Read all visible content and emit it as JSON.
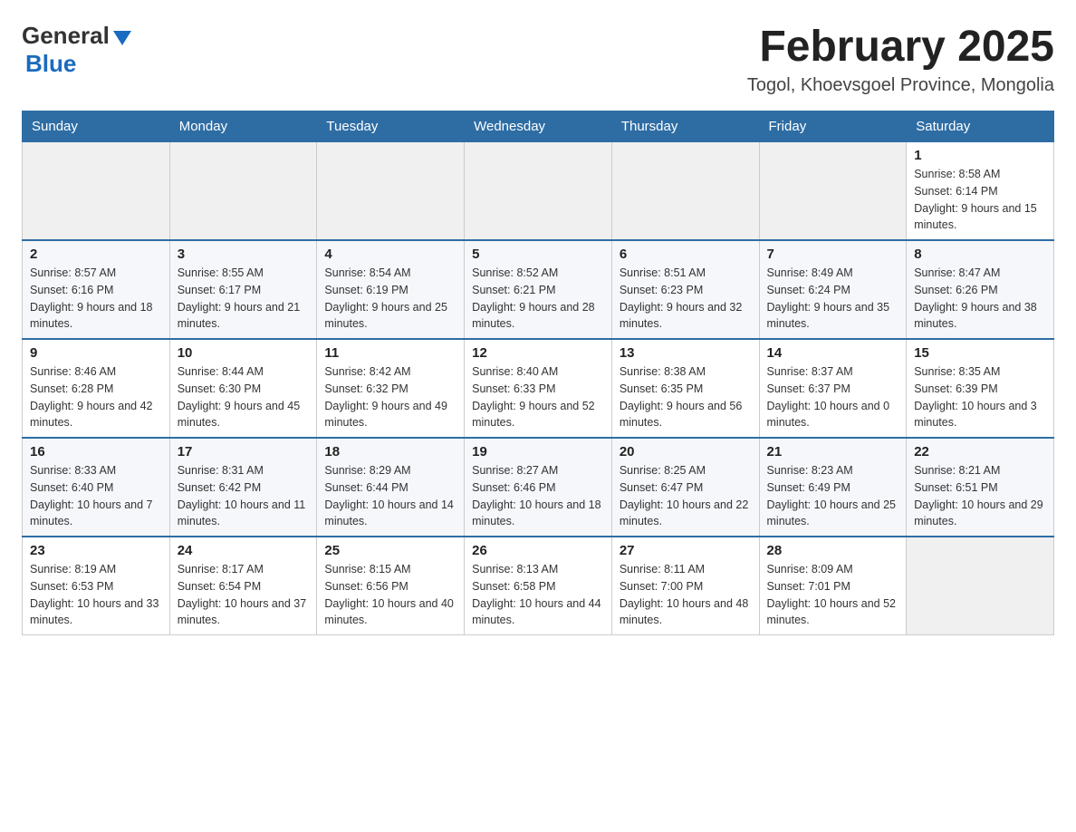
{
  "header": {
    "logo_general": "General",
    "logo_blue": "Blue",
    "month_title": "February 2025",
    "location": "Togol, Khoevsgoel Province, Mongolia"
  },
  "weekdays": [
    "Sunday",
    "Monday",
    "Tuesday",
    "Wednesday",
    "Thursday",
    "Friday",
    "Saturday"
  ],
  "weeks": [
    [
      {
        "day": "",
        "sunrise": "",
        "sunset": "",
        "daylight": "",
        "empty": true
      },
      {
        "day": "",
        "sunrise": "",
        "sunset": "",
        "daylight": "",
        "empty": true
      },
      {
        "day": "",
        "sunrise": "",
        "sunset": "",
        "daylight": "",
        "empty": true
      },
      {
        "day": "",
        "sunrise": "",
        "sunset": "",
        "daylight": "",
        "empty": true
      },
      {
        "day": "",
        "sunrise": "",
        "sunset": "",
        "daylight": "",
        "empty": true
      },
      {
        "day": "",
        "sunrise": "",
        "sunset": "",
        "daylight": "",
        "empty": true
      },
      {
        "day": "1",
        "sunrise": "Sunrise: 8:58 AM",
        "sunset": "Sunset: 6:14 PM",
        "daylight": "Daylight: 9 hours and 15 minutes.",
        "empty": false
      }
    ],
    [
      {
        "day": "2",
        "sunrise": "Sunrise: 8:57 AM",
        "sunset": "Sunset: 6:16 PM",
        "daylight": "Daylight: 9 hours and 18 minutes.",
        "empty": false
      },
      {
        "day": "3",
        "sunrise": "Sunrise: 8:55 AM",
        "sunset": "Sunset: 6:17 PM",
        "daylight": "Daylight: 9 hours and 21 minutes.",
        "empty": false
      },
      {
        "day": "4",
        "sunrise": "Sunrise: 8:54 AM",
        "sunset": "Sunset: 6:19 PM",
        "daylight": "Daylight: 9 hours and 25 minutes.",
        "empty": false
      },
      {
        "day": "5",
        "sunrise": "Sunrise: 8:52 AM",
        "sunset": "Sunset: 6:21 PM",
        "daylight": "Daylight: 9 hours and 28 minutes.",
        "empty": false
      },
      {
        "day": "6",
        "sunrise": "Sunrise: 8:51 AM",
        "sunset": "Sunset: 6:23 PM",
        "daylight": "Daylight: 9 hours and 32 minutes.",
        "empty": false
      },
      {
        "day": "7",
        "sunrise": "Sunrise: 8:49 AM",
        "sunset": "Sunset: 6:24 PM",
        "daylight": "Daylight: 9 hours and 35 minutes.",
        "empty": false
      },
      {
        "day": "8",
        "sunrise": "Sunrise: 8:47 AM",
        "sunset": "Sunset: 6:26 PM",
        "daylight": "Daylight: 9 hours and 38 minutes.",
        "empty": false
      }
    ],
    [
      {
        "day": "9",
        "sunrise": "Sunrise: 8:46 AM",
        "sunset": "Sunset: 6:28 PM",
        "daylight": "Daylight: 9 hours and 42 minutes.",
        "empty": false
      },
      {
        "day": "10",
        "sunrise": "Sunrise: 8:44 AM",
        "sunset": "Sunset: 6:30 PM",
        "daylight": "Daylight: 9 hours and 45 minutes.",
        "empty": false
      },
      {
        "day": "11",
        "sunrise": "Sunrise: 8:42 AM",
        "sunset": "Sunset: 6:32 PM",
        "daylight": "Daylight: 9 hours and 49 minutes.",
        "empty": false
      },
      {
        "day": "12",
        "sunrise": "Sunrise: 8:40 AM",
        "sunset": "Sunset: 6:33 PM",
        "daylight": "Daylight: 9 hours and 52 minutes.",
        "empty": false
      },
      {
        "day": "13",
        "sunrise": "Sunrise: 8:38 AM",
        "sunset": "Sunset: 6:35 PM",
        "daylight": "Daylight: 9 hours and 56 minutes.",
        "empty": false
      },
      {
        "day": "14",
        "sunrise": "Sunrise: 8:37 AM",
        "sunset": "Sunset: 6:37 PM",
        "daylight": "Daylight: 10 hours and 0 minutes.",
        "empty": false
      },
      {
        "day": "15",
        "sunrise": "Sunrise: 8:35 AM",
        "sunset": "Sunset: 6:39 PM",
        "daylight": "Daylight: 10 hours and 3 minutes.",
        "empty": false
      }
    ],
    [
      {
        "day": "16",
        "sunrise": "Sunrise: 8:33 AM",
        "sunset": "Sunset: 6:40 PM",
        "daylight": "Daylight: 10 hours and 7 minutes.",
        "empty": false
      },
      {
        "day": "17",
        "sunrise": "Sunrise: 8:31 AM",
        "sunset": "Sunset: 6:42 PM",
        "daylight": "Daylight: 10 hours and 11 minutes.",
        "empty": false
      },
      {
        "day": "18",
        "sunrise": "Sunrise: 8:29 AM",
        "sunset": "Sunset: 6:44 PM",
        "daylight": "Daylight: 10 hours and 14 minutes.",
        "empty": false
      },
      {
        "day": "19",
        "sunrise": "Sunrise: 8:27 AM",
        "sunset": "Sunset: 6:46 PM",
        "daylight": "Daylight: 10 hours and 18 minutes.",
        "empty": false
      },
      {
        "day": "20",
        "sunrise": "Sunrise: 8:25 AM",
        "sunset": "Sunset: 6:47 PM",
        "daylight": "Daylight: 10 hours and 22 minutes.",
        "empty": false
      },
      {
        "day": "21",
        "sunrise": "Sunrise: 8:23 AM",
        "sunset": "Sunset: 6:49 PM",
        "daylight": "Daylight: 10 hours and 25 minutes.",
        "empty": false
      },
      {
        "day": "22",
        "sunrise": "Sunrise: 8:21 AM",
        "sunset": "Sunset: 6:51 PM",
        "daylight": "Daylight: 10 hours and 29 minutes.",
        "empty": false
      }
    ],
    [
      {
        "day": "23",
        "sunrise": "Sunrise: 8:19 AM",
        "sunset": "Sunset: 6:53 PM",
        "daylight": "Daylight: 10 hours and 33 minutes.",
        "empty": false
      },
      {
        "day": "24",
        "sunrise": "Sunrise: 8:17 AM",
        "sunset": "Sunset: 6:54 PM",
        "daylight": "Daylight: 10 hours and 37 minutes.",
        "empty": false
      },
      {
        "day": "25",
        "sunrise": "Sunrise: 8:15 AM",
        "sunset": "Sunset: 6:56 PM",
        "daylight": "Daylight: 10 hours and 40 minutes.",
        "empty": false
      },
      {
        "day": "26",
        "sunrise": "Sunrise: 8:13 AM",
        "sunset": "Sunset: 6:58 PM",
        "daylight": "Daylight: 10 hours and 44 minutes.",
        "empty": false
      },
      {
        "day": "27",
        "sunrise": "Sunrise: 8:11 AM",
        "sunset": "Sunset: 7:00 PM",
        "daylight": "Daylight: 10 hours and 48 minutes.",
        "empty": false
      },
      {
        "day": "28",
        "sunrise": "Sunrise: 8:09 AM",
        "sunset": "Sunset: 7:01 PM",
        "daylight": "Daylight: 10 hours and 52 minutes.",
        "empty": false
      },
      {
        "day": "",
        "sunrise": "",
        "sunset": "",
        "daylight": "",
        "empty": true
      }
    ]
  ]
}
